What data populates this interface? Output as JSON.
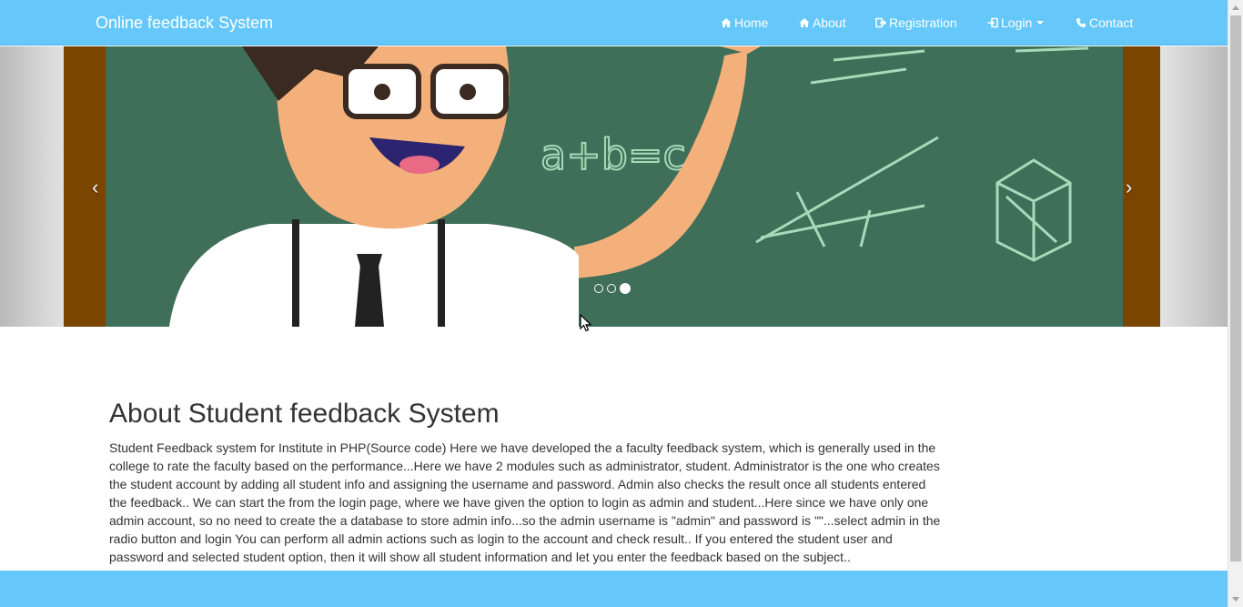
{
  "navbar": {
    "brand": "Online feedback System",
    "items": [
      {
        "label": "Home",
        "icon": "home-icon"
      },
      {
        "label": "About",
        "icon": "home-icon"
      },
      {
        "label": "Registration",
        "icon": "sign-out-icon"
      },
      {
        "label": "Login",
        "icon": "sign-in-icon",
        "dropdown": true
      },
      {
        "label": "Contact",
        "icon": "phone-icon"
      }
    ]
  },
  "carousel": {
    "prev_glyph": "‹",
    "next_glyph": "›",
    "slide_count": 3,
    "active_slide": 3,
    "chalk_text": "a+b=c"
  },
  "about": {
    "title": "About Student feedback System",
    "text": "Student Feedback system for Institute in PHP(Source code) Here we have developed the a faculty feedback system, which is generally used in the college to rate the faculty based on the performance...Here we have 2 modules such as administrator, student. Administrator is the one who creates the student account by adding all student info and assigning the username and password. Admin also checks the result once all students entered the feedback.. We can start the from the login page, where we have given the option to login as admin and student...Here since we have only one admin account, so no need to create the a database to store admin info...so the admin username is \"admin\" and password is \"\"...select admin in the radio button and login You can perform all admin actions such as login to the account and check result.. If you entered the student user and password and selected student option, then it will show all student information and let you enter the feedback based on the subject.."
  },
  "colors": {
    "navbar": "#66c8fa",
    "footer": "#66c8fa",
    "chalkboard": "#3f6e59",
    "frame": "#7a4500"
  }
}
